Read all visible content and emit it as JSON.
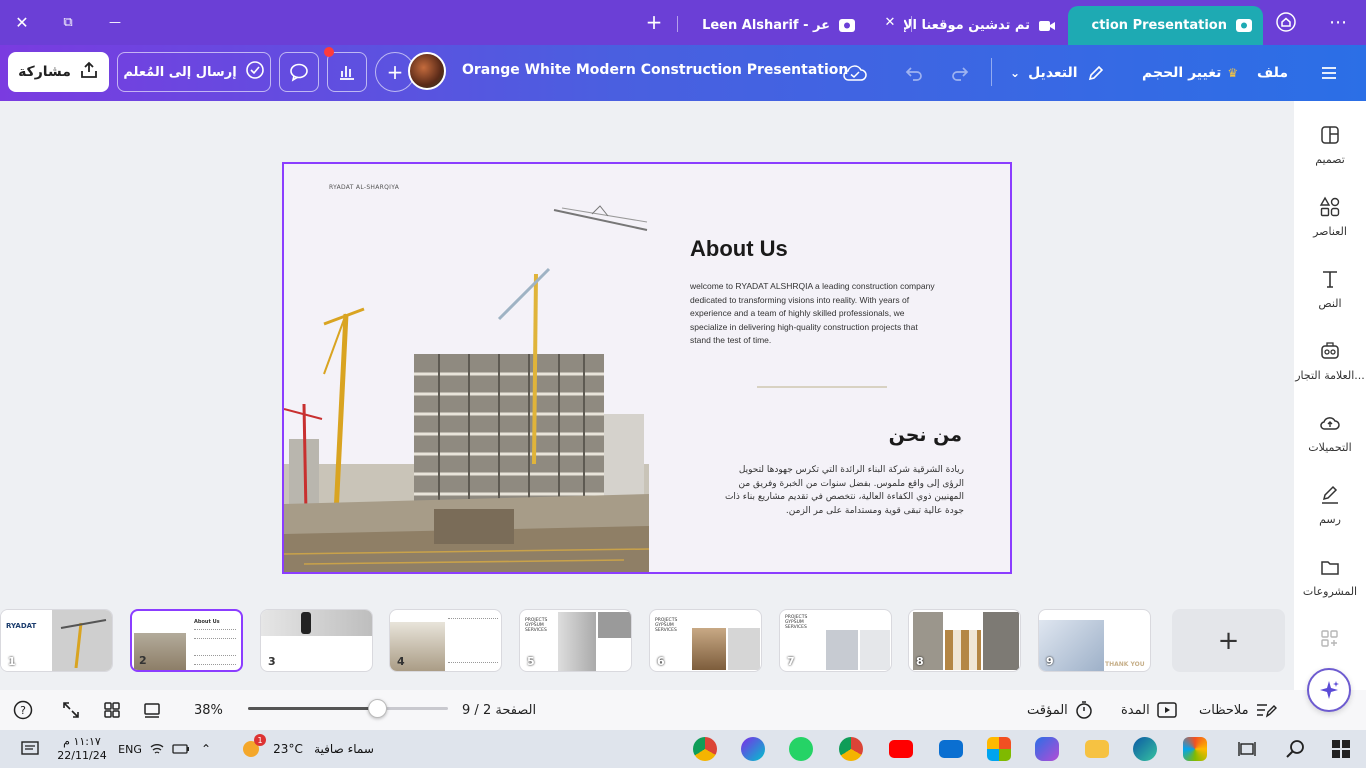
{
  "browser": {
    "tabs": [
      {
        "title": "ction Presentation",
        "active": true
      },
      {
        "title": "تم تدشين موقعنا الإلكـ",
        "active": false
      },
      {
        "title": "Leen Alsharif - عر",
        "active": false
      }
    ],
    "new_tab": "+",
    "more": "⋯",
    "close_window": "✕",
    "restore": "⧉",
    "minimize": "—"
  },
  "toolbar": {
    "share_label": "مشاركة",
    "send_label": "إرسال إلى المُعلم",
    "doc_title": "Orange White Modern Construction Presentation",
    "edit_label": "التعديل",
    "resize_label": "تغيير الحجم",
    "file_label": "ملف",
    "add_label": "+"
  },
  "sidebar": {
    "items": [
      {
        "label": "تصميم",
        "icon": "layout-icon"
      },
      {
        "label": "العناصر",
        "icon": "elements-icon"
      },
      {
        "label": "النص",
        "icon": "text-icon"
      },
      {
        "label": "العلامة التجار...",
        "icon": "brand-icon"
      },
      {
        "label": "التحميلات",
        "icon": "upload-icon"
      },
      {
        "label": "رسم",
        "icon": "draw-icon"
      },
      {
        "label": "المشروعات",
        "icon": "folder-icon"
      }
    ]
  },
  "slide": {
    "brand": "RYADAT AL-SHARQIYA",
    "title_en": "About Us",
    "body_en": "welcome  to RYADAT ALSHRQIA a leading construction company dedicated to transforming visions into reality. With years of experience and a team of highly skilled professionals, we specialize in delivering high-quality construction projects that stand the test of time.",
    "title_ar": "من نحن",
    "body_ar": "ريادة الشرقية شركة البناء الرائدة التي تكرس جهودها لتحويل الرؤى إلى واقع ملموس. بفضل سنوات من الخبرة وفريق من المهنيين ذوي الكفاءة العالية، نتخصص في تقديم مشاريع بناء ذات جودة عالية تبقى قوية ومستدامة على مر الزمن."
  },
  "thumbnails": [
    {
      "num": "1",
      "text": "RYADAT"
    },
    {
      "num": "2",
      "text": "About Us"
    },
    {
      "num": "3",
      "text": ""
    },
    {
      "num": "4",
      "text": ""
    },
    {
      "num": "5",
      "text": "PROJECTS GYPSUM SERVICES"
    },
    {
      "num": "6",
      "text": "PROJECTS GYPSUM SERVICES"
    },
    {
      "num": "7",
      "text": "PROJECTS GYPSUM SERVICES"
    },
    {
      "num": "8",
      "text": ""
    },
    {
      "num": "9",
      "text": "THANK YOU"
    }
  ],
  "bottombar": {
    "zoom": "38%",
    "zoom_level": 0.38,
    "page": "الصفحة 2 / 9",
    "duration": "المدة",
    "timer": "المؤقت",
    "notes": "ملاحظات",
    "help": "?"
  },
  "taskbar": {
    "time": "١١:١٧ م",
    "date": "22/11/24",
    "lang": "ENG",
    "weather_temp": "23°C",
    "weather_desc": "سماء صافية",
    "badge": "1"
  },
  "colors": {
    "tabbar": "#6b3fd6",
    "active_tab": "#1eaab3",
    "accent": "#8b3dff",
    "slide_bg": "#f4f2f8"
  }
}
